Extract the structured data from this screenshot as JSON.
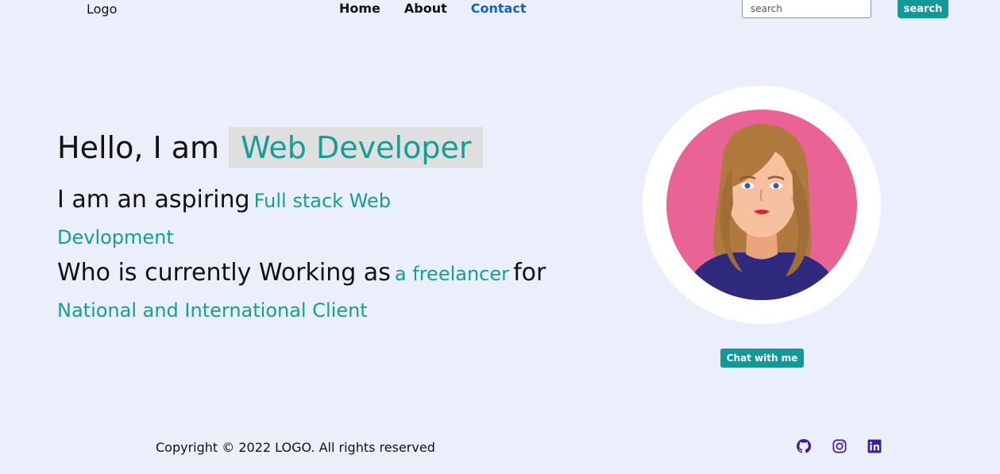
{
  "nav": {
    "logo": "Logo",
    "links": [
      "Home",
      "About",
      "Contact"
    ],
    "search_placeholder": "search",
    "search_button": "search"
  },
  "hero": {
    "greeting": "Hello, I am",
    "role": "Web Developer",
    "line1_prefix": "I am an aspiring",
    "line1_highlight": "Full stack Web",
    "line2_highlight": "Devlopment",
    "line3_prefix": "Who is currently Working as",
    "line3_highlight": "a freelancer",
    "line3_suffix": "for",
    "line4_highlight": "National and International Client"
  },
  "chat_button": "Chat with me",
  "footer": {
    "copyright": "Copyright © 2022 LOGO. All rights reserved",
    "social_icons": [
      "github-icon",
      "instagram-icon",
      "linkedin-icon"
    ]
  },
  "colors": {
    "accent": "#179d98",
    "background": "#ebeffc",
    "active_link": "#0b63c9",
    "avatar_bg": "#e96395",
    "social": "#3f1d99"
  }
}
